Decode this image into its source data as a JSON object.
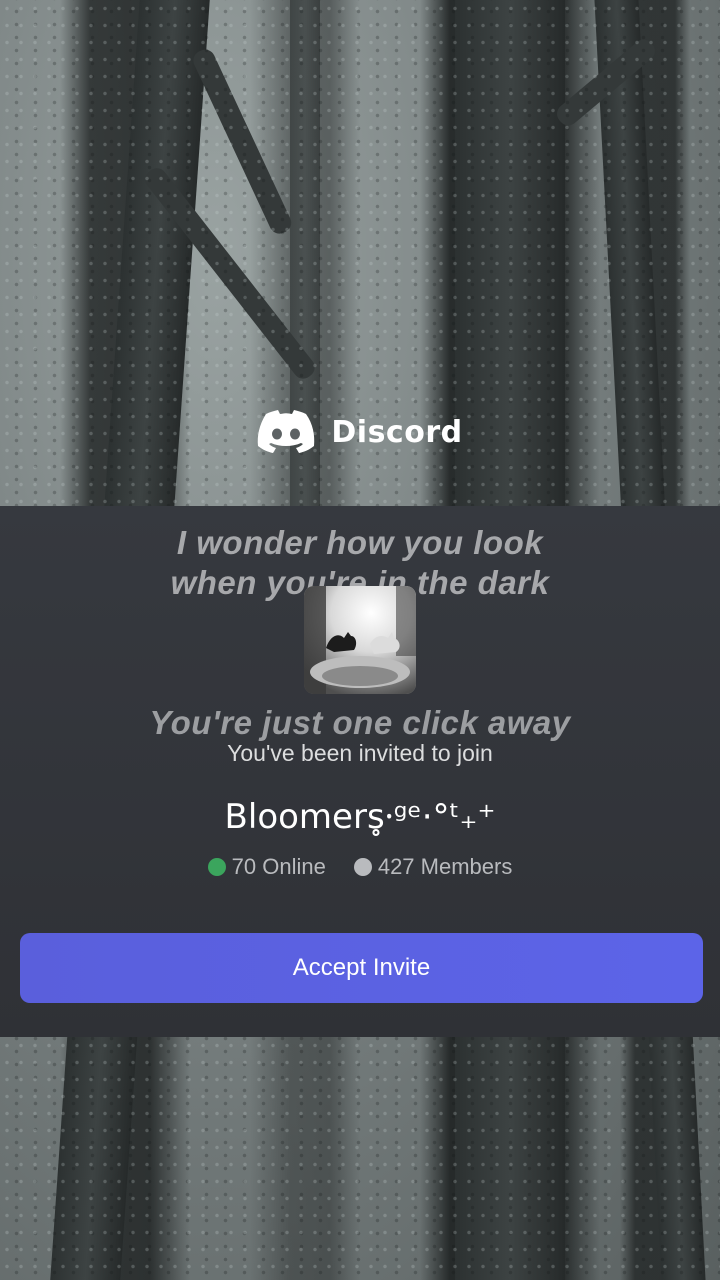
{
  "brand": {
    "name": "Discord",
    "logo_icon": "discord-logo-icon"
  },
  "overlay_text": {
    "line1": "I wonder how you look",
    "line2": "when you're in the dark",
    "line3": "You're just one click away"
  },
  "invite": {
    "intro": "You've been invited to join",
    "server_name": "Bloomers̥⸱ᵍᵉ·°ᵗ₊⁺",
    "online": {
      "label": "70 Online",
      "color": "#3ba55d"
    },
    "members": {
      "label": "427 Members",
      "color": "#b9bbbe"
    },
    "accept_label": "Accept Invite",
    "accent_color": "#5865f2"
  }
}
